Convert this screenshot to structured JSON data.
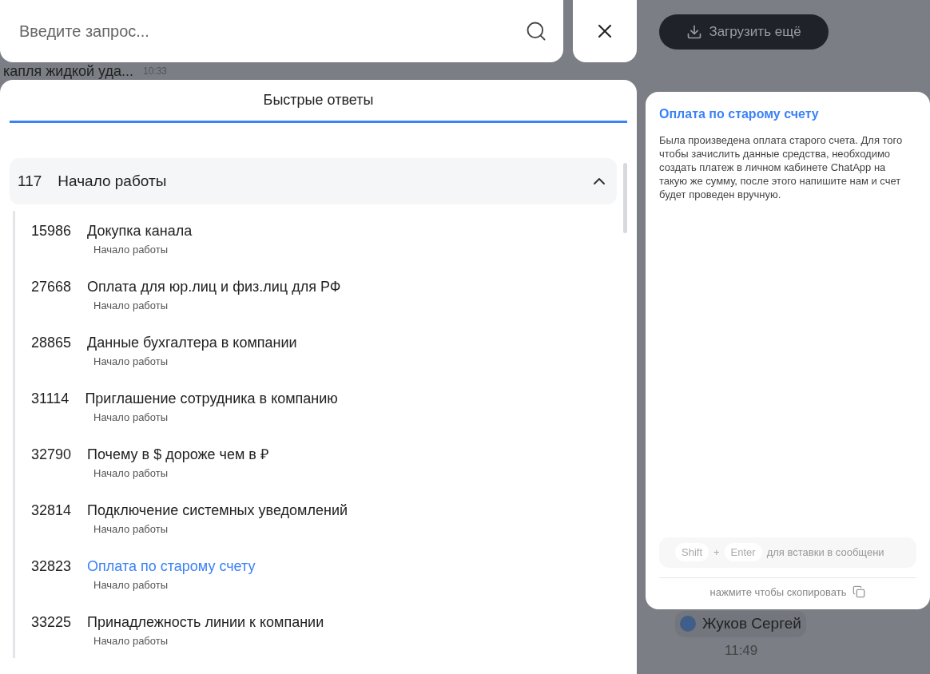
{
  "search": {
    "placeholder": "Введите запрос..."
  },
  "background_chat": {
    "message_preview": "капля жидкой уда...",
    "message_time": "10:33",
    "load_more_button": "Загрузить ещё",
    "author": "Жуков Сергей",
    "author_time": "11:49"
  },
  "tabs": [
    {
      "label": "Быстрые ответы",
      "selected": true
    }
  ],
  "groups": [
    {
      "count": "117",
      "title": "Начало работы",
      "expanded": true,
      "children": [
        {
          "id": "15986",
          "title": "Докупка канала",
          "category": "Начало работы",
          "selected": false
        },
        {
          "id": "27668",
          "title": "Оплата для юр.лиц и физ.лиц для РФ",
          "category": "Начало работы",
          "selected": false
        },
        {
          "id": "28865",
          "title": "Данные бухгалтера в компании",
          "category": "Начало работы",
          "selected": false
        },
        {
          "id": "31114",
          "title": "Приглашение сотрудника в компанию",
          "category": "Начало работы",
          "selected": false
        },
        {
          "id": "32790",
          "title": "Почему в $ дороже чем в ₽",
          "category": "Начало работы",
          "selected": false
        },
        {
          "id": "32814",
          "title": "Подключение системных уведомлений",
          "category": "Начало работы",
          "selected": false
        },
        {
          "id": "32823",
          "title": "Оплата по старому счету",
          "category": "Начало работы",
          "selected": true
        },
        {
          "id": "33225",
          "title": "Принадлежность линии к компании",
          "category": "Начало работы",
          "selected": false
        }
      ]
    }
  ],
  "preview": {
    "title": "Оплата по старому счету",
    "body": "Была произведена оплата старого счета. Для того чтобы зачислить данные средства, необходимо создать платеж в личном кабинете ChatApp на такую же сумму, после этого напишите нам и счет будет проведен вручную.",
    "key_1": "Shift",
    "plus": "+",
    "key_2": "Enter",
    "hint": "для вставки в сообщени",
    "copy_hint": "нажмите чтобы скопировать"
  }
}
